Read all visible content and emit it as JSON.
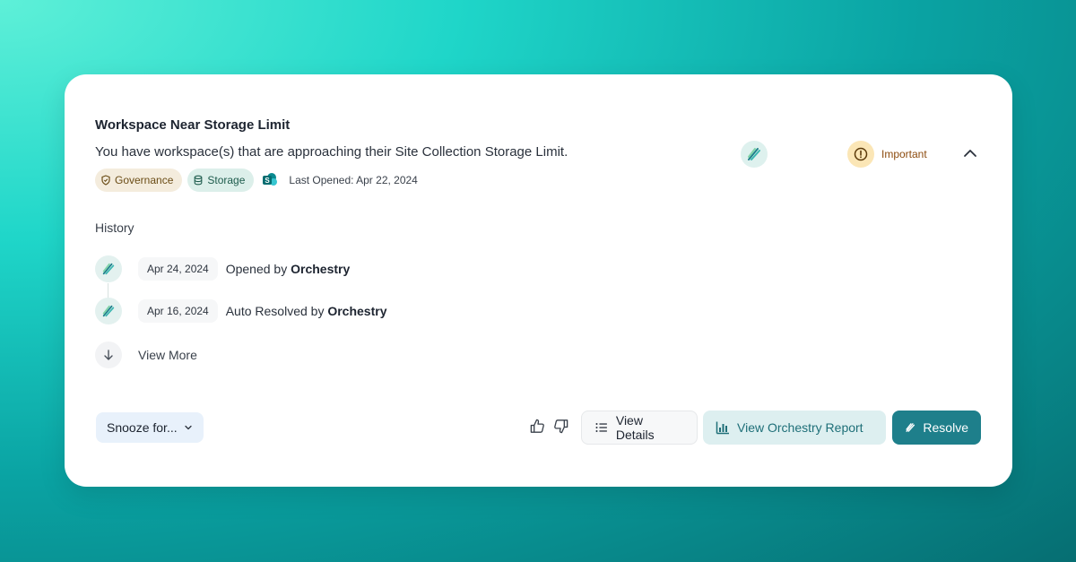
{
  "alert": {
    "title": "Workspace Near Storage Limit",
    "description": "You have workspace(s) that are approaching their Site Collection Storage Limit.",
    "tags": [
      {
        "label": "Governance",
        "icon": "shield-icon"
      },
      {
        "label": "Storage",
        "icon": "database-icon"
      }
    ],
    "source_icon": "sharepoint-icon",
    "last_opened": "Last Opened: Apr 22, 2024",
    "importance": "Important",
    "importance_icon": "exclamation-icon"
  },
  "history": {
    "label": "History",
    "entries": [
      {
        "date": "Apr 24, 2024",
        "action": "Opened by",
        "actor": "Orchestry"
      },
      {
        "date": "Apr 16, 2024",
        "action": "Auto Resolved by",
        "actor": "Orchestry"
      }
    ],
    "view_more": "View More"
  },
  "actions": {
    "snooze": "Snooze for...",
    "view_details": "View Details",
    "view_report": "View Orchestry Report",
    "resolve": "Resolve"
  },
  "colors": {
    "accent": "#1e7f8b",
    "important": "#8c4b0e",
    "important_bg": "#fbe6b6"
  }
}
